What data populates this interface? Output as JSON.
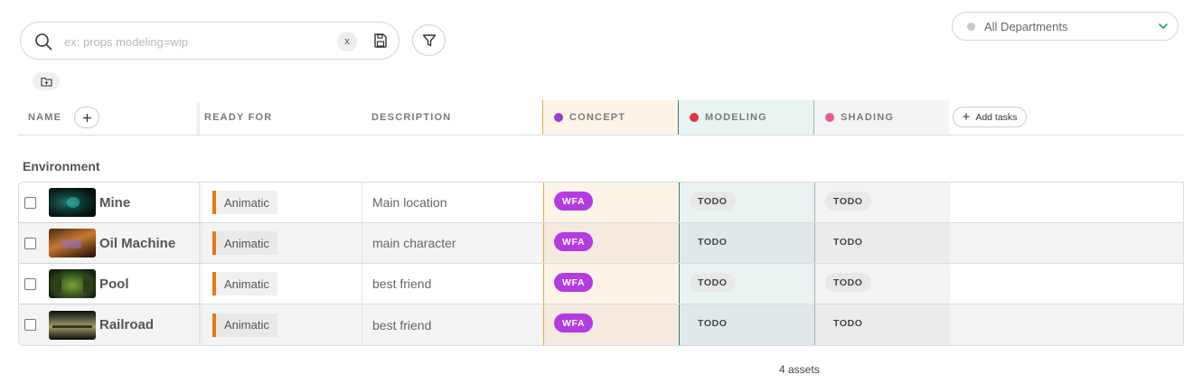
{
  "search": {
    "placeholder": "ex: props modeling=wip",
    "clear_label": "x"
  },
  "department_filter": {
    "value": "All Departments"
  },
  "columns": {
    "name": "NAME",
    "ready_for": "READY FOR",
    "description": "DESCRIPTION",
    "tasks": [
      {
        "label": "CONCEPT",
        "color": "#9b3fc9"
      },
      {
        "label": "MODELING",
        "color": "#e0363f"
      },
      {
        "label": "SHADING",
        "color": "#e85d8f"
      }
    ],
    "add_tasks": "Add tasks"
  },
  "group": {
    "title": "Environment"
  },
  "rows": [
    {
      "name": "Mine",
      "ready_for": "Animatic",
      "description": "Main location",
      "concept": "WFA",
      "modeling": "TODO",
      "shading": "TODO"
    },
    {
      "name": "Oil Machine",
      "ready_for": "Animatic",
      "description": "main character",
      "concept": "WFA",
      "modeling": "TODO",
      "shading": "TODO"
    },
    {
      "name": "Pool",
      "ready_for": "Animatic",
      "description": "best friend",
      "concept": "WFA",
      "modeling": "TODO",
      "shading": "TODO"
    },
    {
      "name": "Railroad",
      "ready_for": "Animatic",
      "description": "best friend",
      "concept": "WFA",
      "modeling": "TODO",
      "shading": "TODO"
    }
  ],
  "footer": {
    "count": "4 assets"
  },
  "colors": {
    "wfa": "#b33be0",
    "ready_bar": "#e47a14"
  }
}
